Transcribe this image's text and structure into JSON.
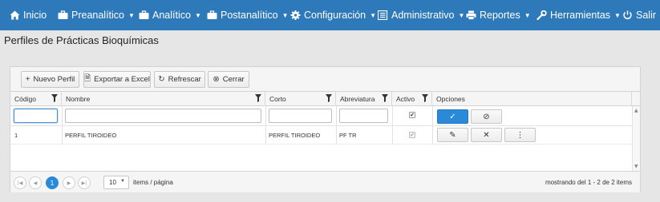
{
  "navbar": {
    "items": [
      {
        "label": "Inicio",
        "icon": "home-icon",
        "dropdown": false
      },
      {
        "label": "Preanalítico",
        "icon": "briefcase-icon",
        "dropdown": true
      },
      {
        "label": "Analítico",
        "icon": "briefcase-icon",
        "dropdown": true
      },
      {
        "label": "Postanalítico",
        "icon": "briefcase-icon",
        "dropdown": true
      },
      {
        "label": "Configuración",
        "icon": "gear-icon",
        "dropdown": true
      },
      {
        "label": "Administrativo",
        "icon": "list-icon",
        "dropdown": true
      },
      {
        "label": "Reportes",
        "icon": "print-icon",
        "dropdown": true
      },
      {
        "label": "Herramientas",
        "icon": "wrench-icon",
        "dropdown": true
      },
      {
        "label": "Salir",
        "icon": "power-icon",
        "dropdown": false
      }
    ]
  },
  "page": {
    "title": "Perfiles de Prácticas Bioquímicas"
  },
  "toolbar": {
    "new_label": "Nuevo Perfil",
    "export_label": "Exportar a Excel",
    "refresh_label": "Refrescar",
    "close_label": "Cerrar"
  },
  "grid": {
    "columns": [
      "Código",
      "Nombre",
      "Corto",
      "Abreviatura",
      "Activo",
      "Opciones"
    ],
    "rows": [
      {
        "codigo": "1",
        "nombre": "PERFIL TIROIDEO",
        "corto": "PERFIL TIROIDEO",
        "abreviatura": "PF TR",
        "activo": true
      }
    ],
    "filter_activo": true
  },
  "pager": {
    "current_page": "1",
    "page_size": "10",
    "page_size_label": "items / página",
    "info": "mostrando del 1 - 2 de 2 items"
  },
  "colors": {
    "navbar": "#2e79b9",
    "primary": "#2b8ad8"
  }
}
